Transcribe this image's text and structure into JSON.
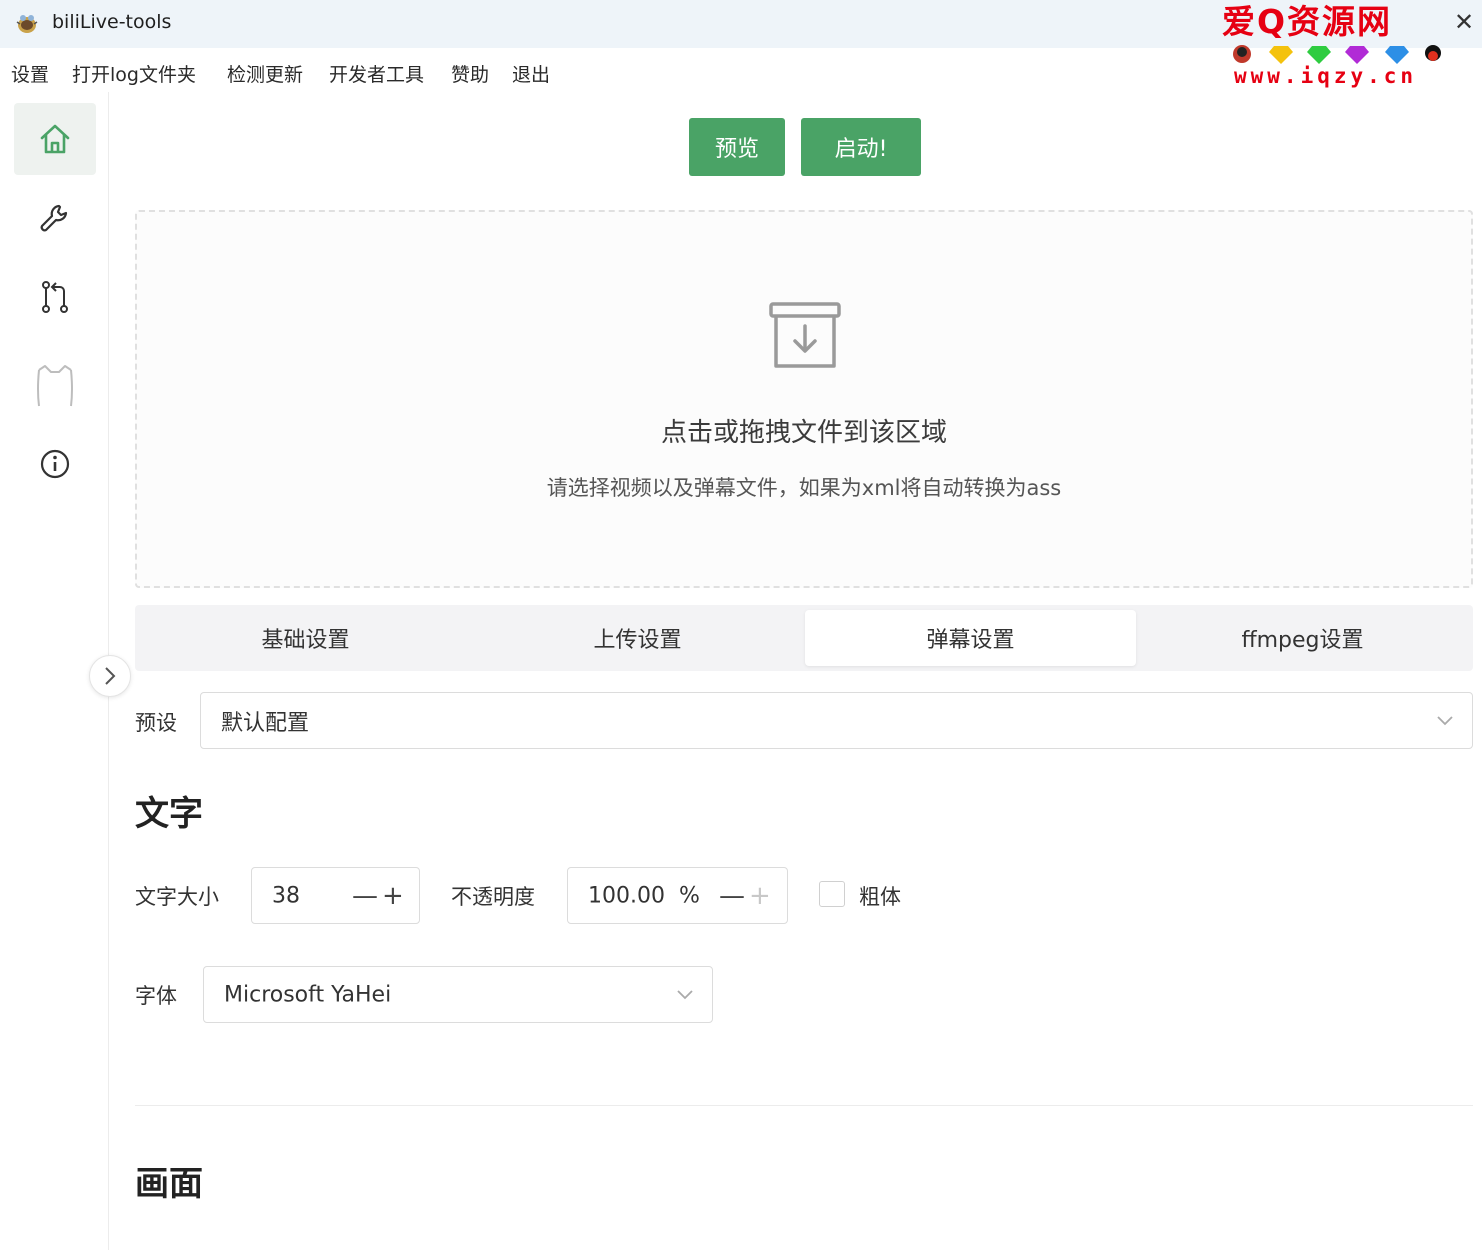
{
  "window": {
    "title": "biliLive-tools",
    "close_glyph": "✕",
    "icon": "app-bug-icon"
  },
  "watermark": {
    "title": "爱Q资源网",
    "url": "www.iqzy.cn"
  },
  "menu": {
    "items": [
      "设置",
      "打开log文件夹",
      "检测更新",
      "开发者工具",
      "赞助",
      "退出"
    ]
  },
  "sidebar": {
    "items": [
      {
        "icon": "home-icon",
        "active": true
      },
      {
        "icon": "wrench-icon",
        "active": false
      },
      {
        "icon": "git-compare-icon",
        "active": false
      },
      {
        "icon": "ghost-outline-icon",
        "active": false
      },
      {
        "icon": "info-icon",
        "active": false
      }
    ],
    "collapse_icon": "chevron-right-icon"
  },
  "actions": {
    "preview_label": "预览",
    "start_label": "启动!"
  },
  "dropzone": {
    "title": "点击或拖拽文件到该区域",
    "subtitle": "请选择视频以及弹幕文件，如果为xml将自动转换为ass",
    "icon": "archive-download-icon"
  },
  "tabs": [
    {
      "label": "基础设置",
      "active": false
    },
    {
      "label": "上传设置",
      "active": false
    },
    {
      "label": "弹幕设置",
      "active": true
    },
    {
      "label": "ffmpeg设置",
      "active": false
    }
  ],
  "preset": {
    "label": "预设",
    "value": "默认配置"
  },
  "text_section": {
    "title": "文字",
    "font_size": {
      "label": "文字大小",
      "value": "38",
      "minus": "—",
      "plus": "+"
    },
    "opacity": {
      "label": "不透明度",
      "value": "100.00  %",
      "minus": "—",
      "plus": "+"
    },
    "bold": {
      "label": "粗体",
      "checked": false
    },
    "font": {
      "label": "字体",
      "value": "Microsoft YaHei"
    }
  },
  "screen_section": {
    "title": "画面"
  },
  "colors": {
    "accent": "#4aa366",
    "titlebar": "#eef4f9",
    "watermark_red": "#e60012"
  }
}
